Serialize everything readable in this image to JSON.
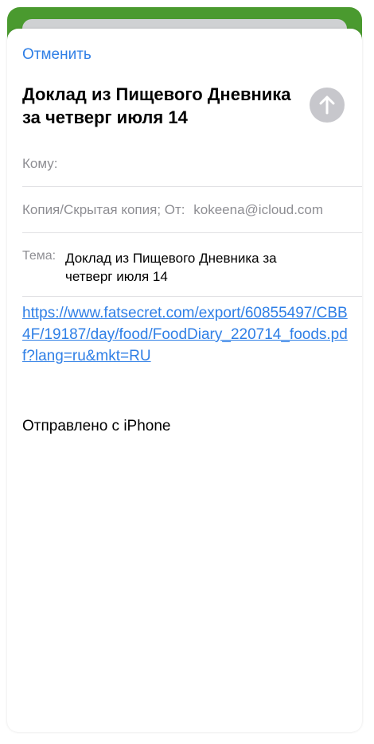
{
  "header": {
    "cancel_label": "Отменить",
    "title": "Доклад из Пищевого Дневника за четверг июля 14",
    "send_icon": "arrow-up-icon"
  },
  "fields": {
    "to_label": "Кому:",
    "cc_label": "Копия/Скрытая копия; От:",
    "from_value": "kokeena@icloud.com",
    "subject_label": "Тема:",
    "subject_value": "Доклад из Пищевого Дневника за четверг июля 14"
  },
  "body": {
    "link": "https://www.fatsecret.com/export/60855497/CBB4F/19187/day/food/FoodDiary_220714_foods.pdf?lang=ru&mkt=RU",
    "signature": "Отправлено с iPhone"
  },
  "colors": {
    "accent": "#2f7fe6",
    "background_app": "#4a9a2f",
    "send_disabled": "#c7c7cc"
  }
}
